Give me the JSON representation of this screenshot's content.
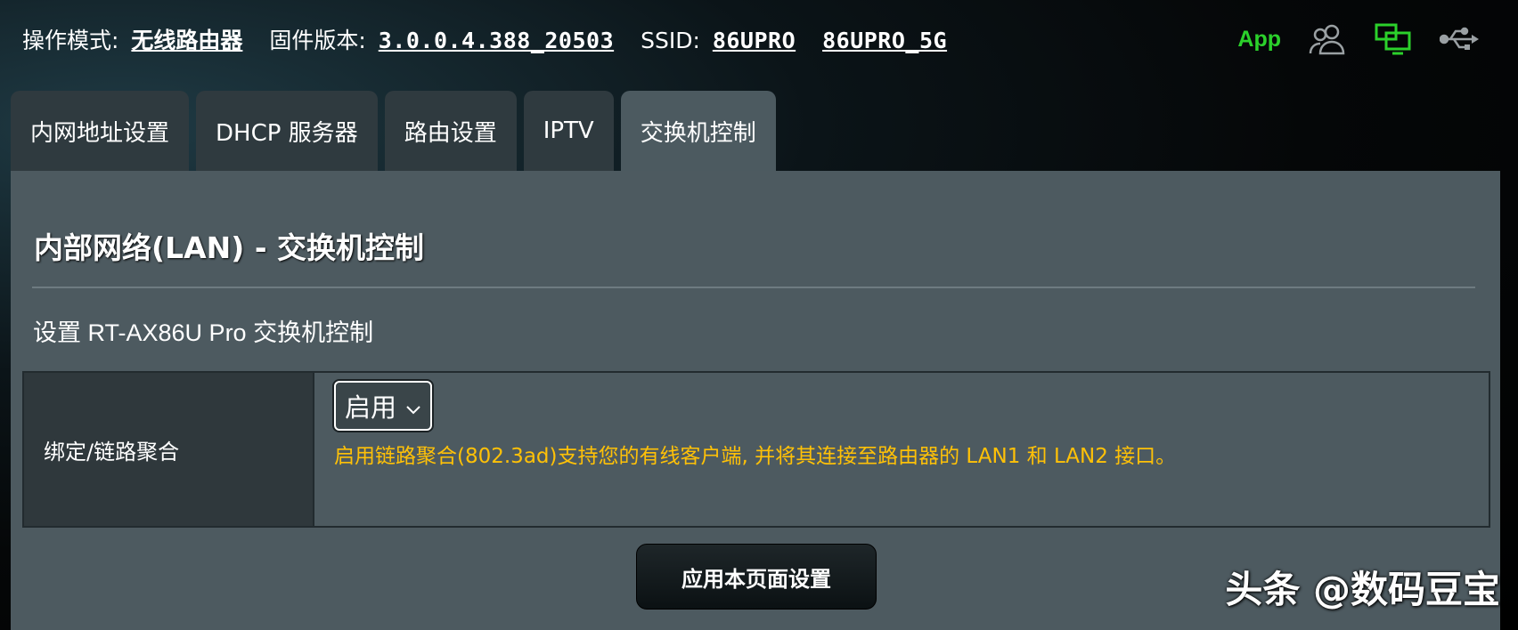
{
  "status_bar": {
    "mode_label": "操作模式:",
    "mode_value": "无线路由器",
    "firmware_label": "固件版本:",
    "firmware_value": "3.0.0.4.388_20503",
    "ssid_label": "SSID:",
    "ssid_1": "86UPRO",
    "ssid_2": "86UPRO_5G",
    "app_link": "App",
    "icons": [
      "users-icon",
      "network-monitor-icon",
      "usb-icon"
    ],
    "icon_colors": {
      "app": "#2bd12b",
      "users": "#9aa0a3",
      "network": "#2bd12b",
      "usb": "#9aa0a3"
    }
  },
  "tabs": [
    {
      "label": "内网地址设置",
      "active": false
    },
    {
      "label": "DHCP 服务器",
      "active": false
    },
    {
      "label": "路由设置",
      "active": false
    },
    {
      "label": "IPTV",
      "active": false
    },
    {
      "label": "交换机控制",
      "active": true
    }
  ],
  "main": {
    "title": "内部网络(LAN) - 交换机控制",
    "subtitle": "设置 RT-AX86U Pro 交换机控制",
    "setting": {
      "label": "绑定/链路聚合",
      "selected_option": "启用",
      "hint": "启用链路聚合(802.3ad)支持您的有线客户端, 并将其连接至路由器的 LAN1 和 LAN2 接口。"
    },
    "apply_button": "应用本页面设置"
  },
  "watermark": "头条 @数码豆宝",
  "colors": {
    "hint": "#ffc107",
    "panel": "#4d5a60",
    "tab": "#2f3a3f",
    "tab_active": "#4c5a60"
  }
}
